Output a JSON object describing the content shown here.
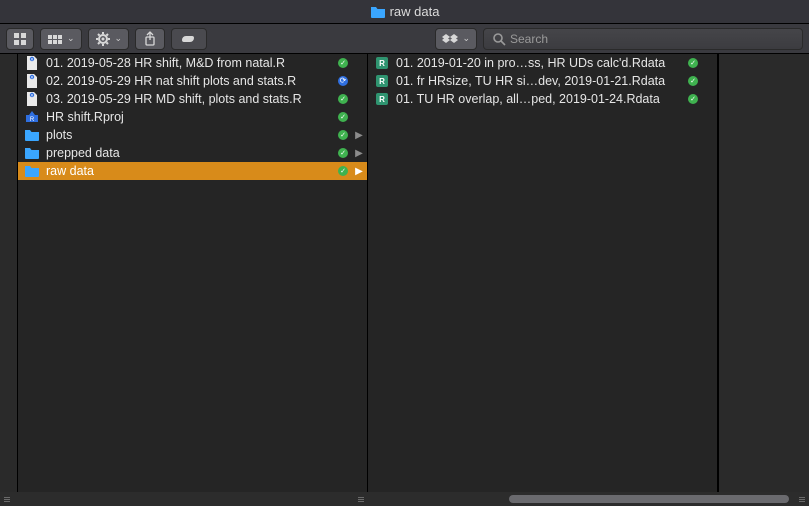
{
  "title": {
    "label": "raw data"
  },
  "toolbar": {
    "search_placeholder": "Search"
  },
  "columns": [
    {
      "items": [
        {
          "icon": "r-file",
          "label": "01. 2019-05-28 HR shift, M&D from natal.R",
          "status": "ok",
          "expandable": false
        },
        {
          "icon": "r-file",
          "label": "02. 2019-05-29 HR nat shift plots and stats.R",
          "status": "sync",
          "expandable": false
        },
        {
          "icon": "r-file",
          "label": "03. 2019-05-29 HR MD shift, plots and stats.R",
          "status": "ok",
          "expandable": false
        },
        {
          "icon": "rproj",
          "label": "HR shift.Rproj",
          "status": "ok",
          "expandable": false
        },
        {
          "icon": "folder",
          "label": "plots",
          "status": "ok",
          "expandable": true
        },
        {
          "icon": "folder",
          "label": "prepped data",
          "status": "ok",
          "expandable": true
        },
        {
          "icon": "folder",
          "label": "raw data",
          "status": "ok",
          "expandable": true,
          "selected": true
        }
      ]
    },
    {
      "items": [
        {
          "icon": "rdata",
          "label": "01. 2019-01-20 in pro…ss, HR UDs calc'd.Rdata",
          "status": "ok",
          "expandable": false
        },
        {
          "icon": "rdata",
          "label": "01. fr HRsize, TU HR si…dev, 2019-01-21.Rdata",
          "status": "ok",
          "expandable": false
        },
        {
          "icon": "rdata",
          "label": "01. TU HR overlap, all…ped, 2019-01-24.Rdata",
          "status": "ok",
          "expandable": false
        }
      ]
    }
  ]
}
